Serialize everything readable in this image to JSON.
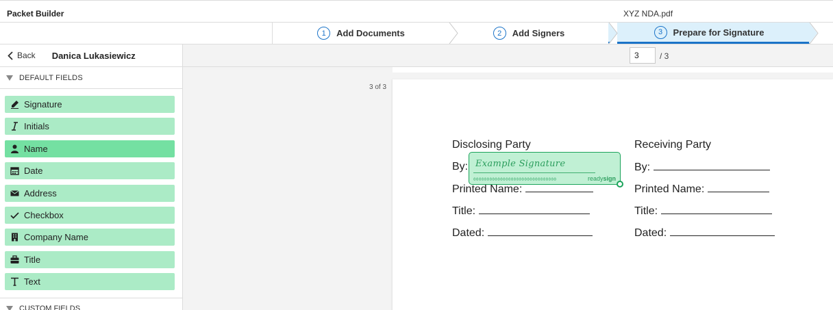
{
  "app": {
    "title": "Packet Builder",
    "file_name": "XYZ NDA.pdf"
  },
  "steps": [
    {
      "num": "1",
      "label": "Add Documents"
    },
    {
      "num": "2",
      "label": "Add Signers"
    },
    {
      "num": "3",
      "label": "Prepare for Signature",
      "active": true
    }
  ],
  "sidebar": {
    "back_label": "Back",
    "signer_name": "Danica Lukasiewicz",
    "default_section": "DEFAULT FIELDS",
    "custom_section": "CUSTOM FIELDS",
    "fields": [
      {
        "label": "Signature",
        "icon": "pen-icon"
      },
      {
        "label": "Initials",
        "icon": "italic-i-icon"
      },
      {
        "label": "Name",
        "icon": "person-icon",
        "selected": true
      },
      {
        "label": "Date",
        "icon": "calendar-icon"
      },
      {
        "label": "Address",
        "icon": "envelope-icon"
      },
      {
        "label": "Checkbox",
        "icon": "checkmark-icon"
      },
      {
        "label": "Company Name",
        "icon": "building-icon"
      },
      {
        "label": "Title",
        "icon": "briefcase-icon"
      },
      {
        "label": "Text",
        "icon": "text-t-icon"
      }
    ]
  },
  "pager": {
    "current": "3",
    "total_label": "/ 3",
    "page_counter": "3 of 3"
  },
  "document": {
    "disclosing_heading": "Disclosing Party",
    "receiving_heading": "Receiving Party",
    "by_label": "By:",
    "printed_name_label": "Printed Name:",
    "title_label": "Title:",
    "dated_label": "Dated:"
  },
  "signature_field": {
    "sample_text": "Example Signature",
    "code": "0000000000000000000000000000000",
    "brand_light": "ready",
    "brand_bold": "sign"
  },
  "colors": {
    "accent": "#1a73c8",
    "field_bg": "#abebc6",
    "field_selected": "#74e0a2",
    "signature_border": "#1aa35a"
  }
}
